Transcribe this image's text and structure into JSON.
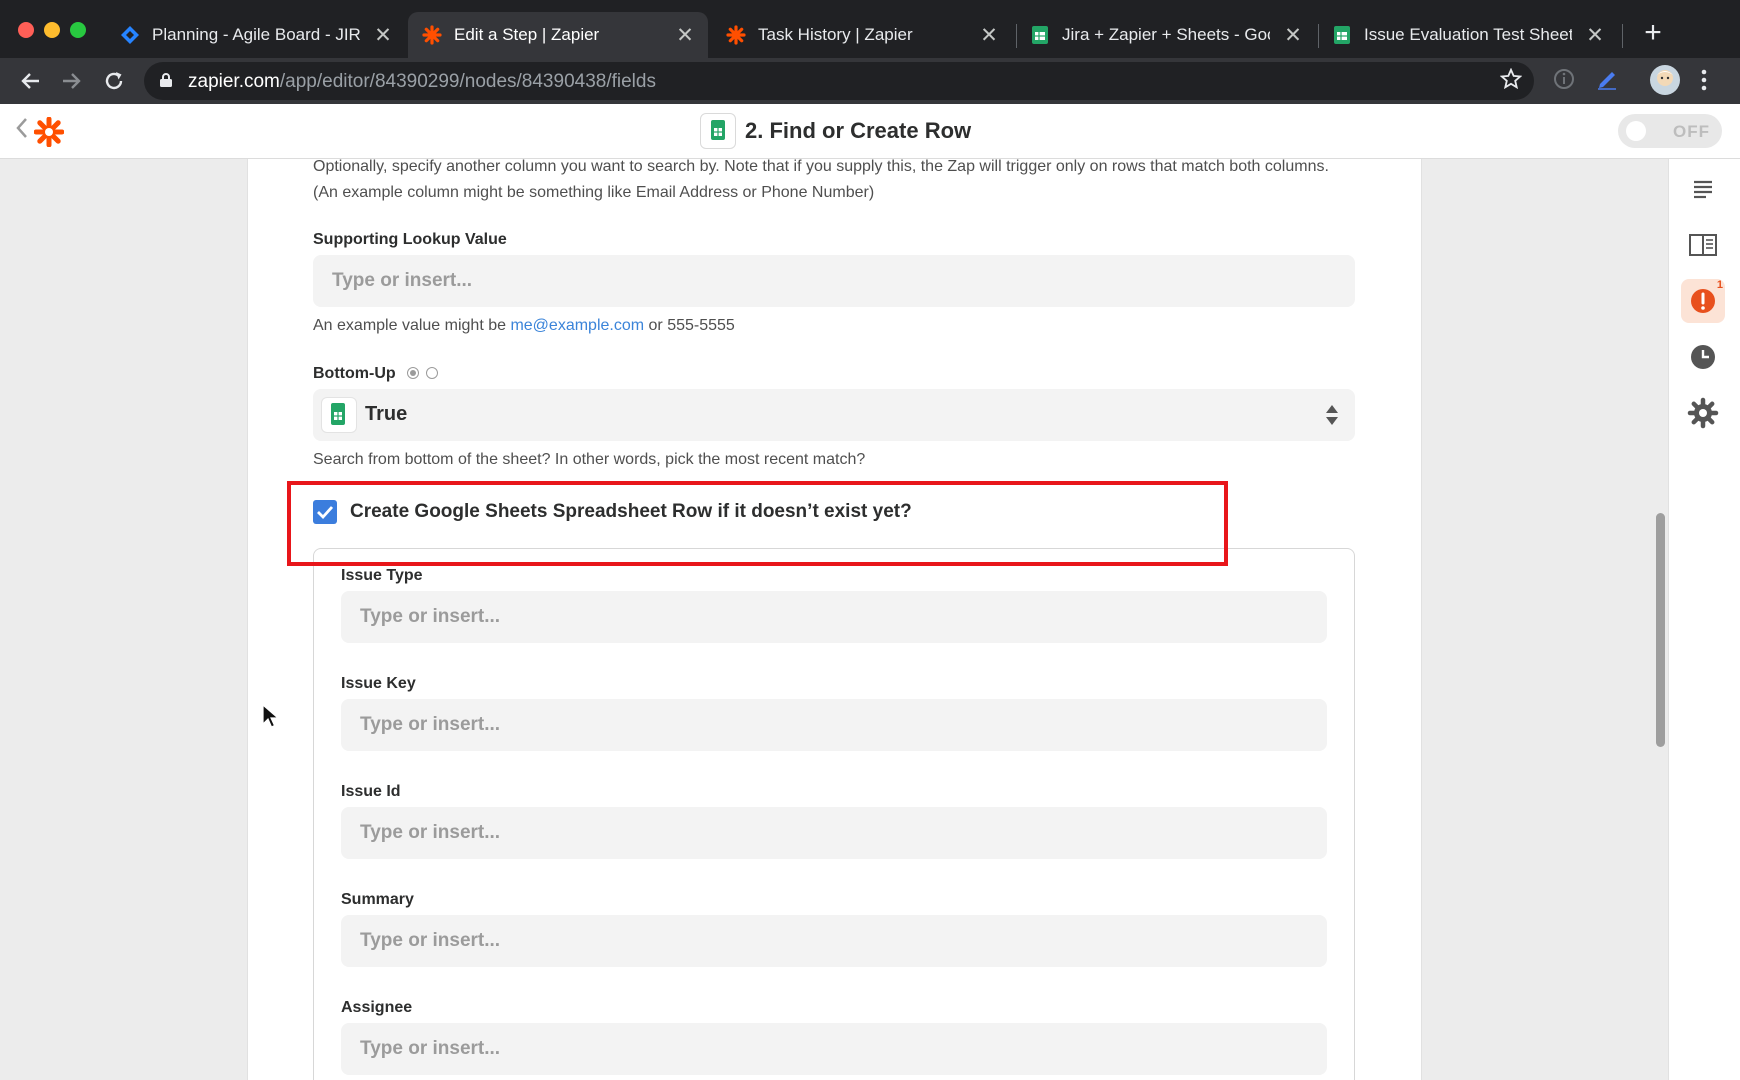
{
  "browser": {
    "tabs": [
      {
        "label": "Planning - Agile Board - JIRA",
        "icon": "jira-icon"
      },
      {
        "label": "Edit a Step | Zapier",
        "icon": "zapier-icon",
        "active": true
      },
      {
        "label": "Task History | Zapier",
        "icon": "zapier-icon"
      },
      {
        "label": "Jira + Zapier + Sheets - Google",
        "icon": "google-sheets-icon"
      },
      {
        "label": "Issue Evaluation Test Sheet - G",
        "icon": "google-sheets-icon"
      }
    ],
    "close_glyph": "✕",
    "new_tab_glyph": "+",
    "url_host": "zapier.com",
    "url_path": "/app/editor/84390299/nodes/84390438/fields"
  },
  "header": {
    "title": "2. Find or Create Row",
    "toggle_label": "OFF"
  },
  "form": {
    "supporting_column_help": "Optionally, specify another column you want to search by. Note that if you supply this, the Zap will trigger only on rows that match both columns. (An example column might be something like Email Address or Phone Number)",
    "supporting_value_label": "Supporting Lookup Value",
    "placeholder": "Type or insert...",
    "example_prefix": "An example value might be ",
    "example_email": "me@example.com",
    "example_suffix": " or 555-5555",
    "bottom_up_label": "Bottom-Up",
    "bottom_up_value": "True",
    "bottom_up_help": "Search from bottom of the sheet? In other words, pick the most recent match?",
    "create_row_label": "Create Google Sheets Spreadsheet Row if it doesn’t exist yet?",
    "create_row_checked": true,
    "create_fields": [
      {
        "label": "Issue Type"
      },
      {
        "label": "Issue Key"
      },
      {
        "label": "Issue Id"
      },
      {
        "label": "Summary"
      },
      {
        "label": "Assignee"
      }
    ]
  },
  "sidebar": {
    "items": [
      "details-icon",
      "guide-icon",
      "alert-icon",
      "history-icon",
      "settings-icon"
    ],
    "alert_count": "1"
  },
  "colors": {
    "zapier_orange": "#ff4f00",
    "checkbox_blue": "#3b7ddd",
    "highlight_red": "#e8161a",
    "sheets_green": "#23a566"
  }
}
